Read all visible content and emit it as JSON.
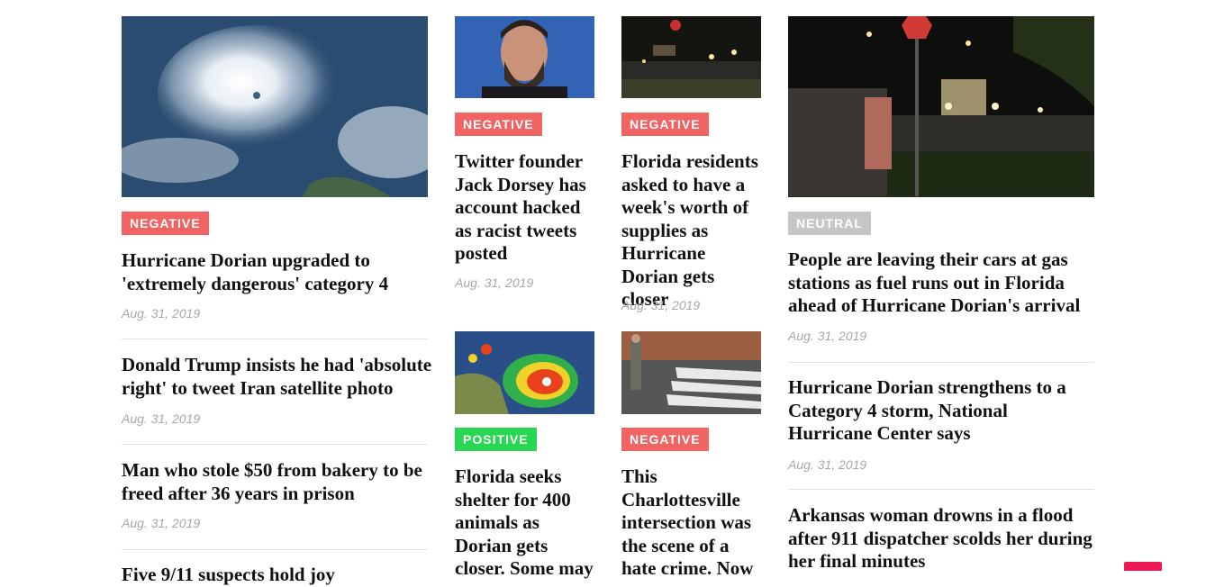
{
  "colors": {
    "negative": "#f26464",
    "positive": "#27d651",
    "neutral": "#c6c6c6",
    "title": "#111111",
    "date": "#a7a7a7",
    "accent": "#ec1a57"
  },
  "left_column": {
    "feature": {
      "sentiment": "NEGATIVE",
      "title": "Hurricane Dorian upgraded to 'extremely dangerous' category 4",
      "date": "Aug. 31, 2019",
      "image": "hurricane-satellite-image"
    },
    "list": [
      {
        "title": "Donald Trump insists he had 'absolute right' to tweet Iran satellite photo",
        "date": "Aug. 31, 2019"
      },
      {
        "title": "Man who stole $50 from bakery to be freed after 36 years in prison",
        "date": "Aug. 31, 2019"
      },
      {
        "title": "Five 9/11 suspects hold joy",
        "date": ""
      }
    ]
  },
  "middle_cards": [
    {
      "sentiment": "NEGATIVE",
      "title": "Twitter founder Jack Dorsey has account hacked as racist tweets posted",
      "date": "Aug. 31, 2019",
      "image": "jack-dorsey-portrait"
    },
    {
      "sentiment": "NEGATIVE",
      "title": "Florida residents asked to have a week's worth of supplies as Hurricane Dorian gets closer",
      "date": "Aug. 31, 2019",
      "image": "night-street-photo"
    },
    {
      "sentiment": "POSITIVE",
      "title": "Florida seeks shelter for 400 animals as Dorian gets closer. Some may",
      "date": "",
      "image": "hurricane-radar-map"
    },
    {
      "sentiment": "NEGATIVE",
      "title": "This Charlottesville intersection was the scene of a hate crime. Now",
      "date": "",
      "image": "crosswalk-photo"
    }
  ],
  "right_column": {
    "feature": {
      "sentiment": "NEUTRAL",
      "title": "People are leaving their cars at gas stations as fuel runs out in Florida ahead of Hurricane Dorian's arrival",
      "date": "Aug. 31, 2019",
      "image": "gas-station-night-photo"
    },
    "list": [
      {
        "title": "Hurricane Dorian strengthens to a Category 4 storm, National Hurricane Center says",
        "date": "Aug. 31, 2019"
      },
      {
        "title": "Arkansas woman drowns in a flood after 911 dispatcher scolds her during her final minutes",
        "date": ""
      }
    ]
  }
}
